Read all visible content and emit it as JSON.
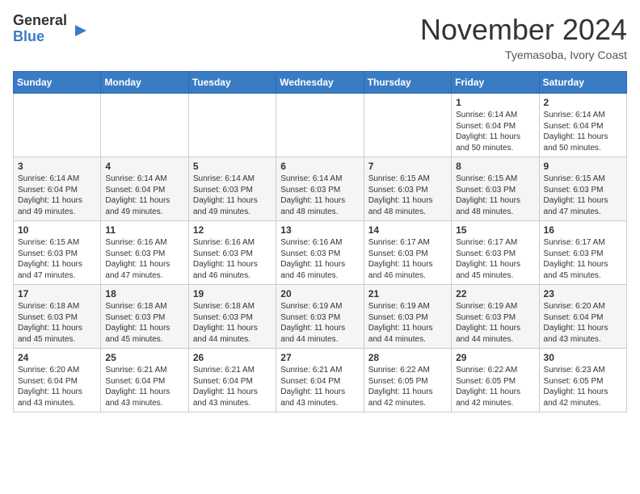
{
  "header": {
    "logo_line1": "General",
    "logo_line2": "Blue",
    "month": "November 2024",
    "location": "Tyemasoba, Ivory Coast"
  },
  "weekdays": [
    "Sunday",
    "Monday",
    "Tuesday",
    "Wednesday",
    "Thursday",
    "Friday",
    "Saturday"
  ],
  "weeks": [
    [
      {
        "day": "",
        "info": ""
      },
      {
        "day": "",
        "info": ""
      },
      {
        "day": "",
        "info": ""
      },
      {
        "day": "",
        "info": ""
      },
      {
        "day": "",
        "info": ""
      },
      {
        "day": "1",
        "info": "Sunrise: 6:14 AM\nSunset: 6:04 PM\nDaylight: 11 hours\nand 50 minutes."
      },
      {
        "day": "2",
        "info": "Sunrise: 6:14 AM\nSunset: 6:04 PM\nDaylight: 11 hours\nand 50 minutes."
      }
    ],
    [
      {
        "day": "3",
        "info": "Sunrise: 6:14 AM\nSunset: 6:04 PM\nDaylight: 11 hours\nand 49 minutes."
      },
      {
        "day": "4",
        "info": "Sunrise: 6:14 AM\nSunset: 6:04 PM\nDaylight: 11 hours\nand 49 minutes."
      },
      {
        "day": "5",
        "info": "Sunrise: 6:14 AM\nSunset: 6:03 PM\nDaylight: 11 hours\nand 49 minutes."
      },
      {
        "day": "6",
        "info": "Sunrise: 6:14 AM\nSunset: 6:03 PM\nDaylight: 11 hours\nand 48 minutes."
      },
      {
        "day": "7",
        "info": "Sunrise: 6:15 AM\nSunset: 6:03 PM\nDaylight: 11 hours\nand 48 minutes."
      },
      {
        "day": "8",
        "info": "Sunrise: 6:15 AM\nSunset: 6:03 PM\nDaylight: 11 hours\nand 48 minutes."
      },
      {
        "day": "9",
        "info": "Sunrise: 6:15 AM\nSunset: 6:03 PM\nDaylight: 11 hours\nand 47 minutes."
      }
    ],
    [
      {
        "day": "10",
        "info": "Sunrise: 6:15 AM\nSunset: 6:03 PM\nDaylight: 11 hours\nand 47 minutes."
      },
      {
        "day": "11",
        "info": "Sunrise: 6:16 AM\nSunset: 6:03 PM\nDaylight: 11 hours\nand 47 minutes."
      },
      {
        "day": "12",
        "info": "Sunrise: 6:16 AM\nSunset: 6:03 PM\nDaylight: 11 hours\nand 46 minutes."
      },
      {
        "day": "13",
        "info": "Sunrise: 6:16 AM\nSunset: 6:03 PM\nDaylight: 11 hours\nand 46 minutes."
      },
      {
        "day": "14",
        "info": "Sunrise: 6:17 AM\nSunset: 6:03 PM\nDaylight: 11 hours\nand 46 minutes."
      },
      {
        "day": "15",
        "info": "Sunrise: 6:17 AM\nSunset: 6:03 PM\nDaylight: 11 hours\nand 45 minutes."
      },
      {
        "day": "16",
        "info": "Sunrise: 6:17 AM\nSunset: 6:03 PM\nDaylight: 11 hours\nand 45 minutes."
      }
    ],
    [
      {
        "day": "17",
        "info": "Sunrise: 6:18 AM\nSunset: 6:03 PM\nDaylight: 11 hours\nand 45 minutes."
      },
      {
        "day": "18",
        "info": "Sunrise: 6:18 AM\nSunset: 6:03 PM\nDaylight: 11 hours\nand 45 minutes."
      },
      {
        "day": "19",
        "info": "Sunrise: 6:18 AM\nSunset: 6:03 PM\nDaylight: 11 hours\nand 44 minutes."
      },
      {
        "day": "20",
        "info": "Sunrise: 6:19 AM\nSunset: 6:03 PM\nDaylight: 11 hours\nand 44 minutes."
      },
      {
        "day": "21",
        "info": "Sunrise: 6:19 AM\nSunset: 6:03 PM\nDaylight: 11 hours\nand 44 minutes."
      },
      {
        "day": "22",
        "info": "Sunrise: 6:19 AM\nSunset: 6:03 PM\nDaylight: 11 hours\nand 44 minutes."
      },
      {
        "day": "23",
        "info": "Sunrise: 6:20 AM\nSunset: 6:04 PM\nDaylight: 11 hours\nand 43 minutes."
      }
    ],
    [
      {
        "day": "24",
        "info": "Sunrise: 6:20 AM\nSunset: 6:04 PM\nDaylight: 11 hours\nand 43 minutes."
      },
      {
        "day": "25",
        "info": "Sunrise: 6:21 AM\nSunset: 6:04 PM\nDaylight: 11 hours\nand 43 minutes."
      },
      {
        "day": "26",
        "info": "Sunrise: 6:21 AM\nSunset: 6:04 PM\nDaylight: 11 hours\nand 43 minutes."
      },
      {
        "day": "27",
        "info": "Sunrise: 6:21 AM\nSunset: 6:04 PM\nDaylight: 11 hours\nand 43 minutes."
      },
      {
        "day": "28",
        "info": "Sunrise: 6:22 AM\nSunset: 6:05 PM\nDaylight: 11 hours\nand 42 minutes."
      },
      {
        "day": "29",
        "info": "Sunrise: 6:22 AM\nSunset: 6:05 PM\nDaylight: 11 hours\nand 42 minutes."
      },
      {
        "day": "30",
        "info": "Sunrise: 6:23 AM\nSunset: 6:05 PM\nDaylight: 11 hours\nand 42 minutes."
      }
    ]
  ]
}
